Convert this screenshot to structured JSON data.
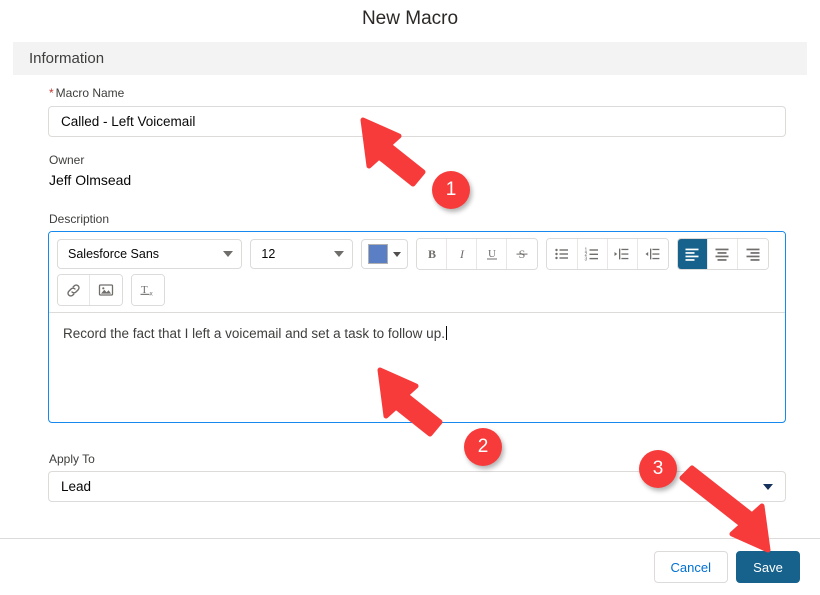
{
  "modal": {
    "title": "New Macro"
  },
  "section": {
    "header": "Information"
  },
  "fields": {
    "macro_name": {
      "label": "Macro Name",
      "required_marker": "*",
      "value": "Called - Left Voicemail",
      "placeholder": ""
    },
    "owner": {
      "label": "Owner",
      "value": "Jeff Olmsead"
    },
    "description": {
      "label": "Description",
      "body_text": "Record the fact that I left a voicemail and set a task to follow up."
    },
    "apply_to": {
      "label": "Apply To",
      "value": "Lead"
    }
  },
  "editor_toolbar": {
    "font_family": "Salesforce Sans",
    "font_size": "12",
    "text_color": "#5b7fc4",
    "buttons": [
      {
        "name": "bold-button",
        "glyph": "B"
      },
      {
        "name": "italic-button",
        "glyph": "I"
      },
      {
        "name": "underline-button",
        "glyph": "U"
      },
      {
        "name": "strikethrough-button",
        "glyph": "S"
      },
      {
        "name": "bulleted-list-button",
        "glyph": "list"
      },
      {
        "name": "numbered-list-button",
        "glyph": "numlist"
      },
      {
        "name": "indent-button",
        "glyph": "indent"
      },
      {
        "name": "outdent-button",
        "glyph": "outdent"
      },
      {
        "name": "align-left-button",
        "glyph": "alignleft",
        "active": true
      },
      {
        "name": "align-center-button",
        "glyph": "aligncenter"
      },
      {
        "name": "align-right-button",
        "glyph": "alignright"
      },
      {
        "name": "insert-link-button",
        "glyph": "link"
      },
      {
        "name": "insert-image-button",
        "glyph": "image"
      },
      {
        "name": "remove-formatting-button",
        "glyph": "Tx"
      }
    ],
    "active_alignment_color": "#16628c"
  },
  "footer": {
    "cancel_label": "Cancel",
    "save_label": "Save",
    "save_color": "#16628c"
  },
  "annotations": {
    "color": "#f73b3b",
    "items": [
      {
        "number": "1",
        "target": "macro-name-input"
      },
      {
        "number": "2",
        "target": "description-editor-body"
      },
      {
        "number": "3",
        "target": "save-button"
      }
    ]
  }
}
